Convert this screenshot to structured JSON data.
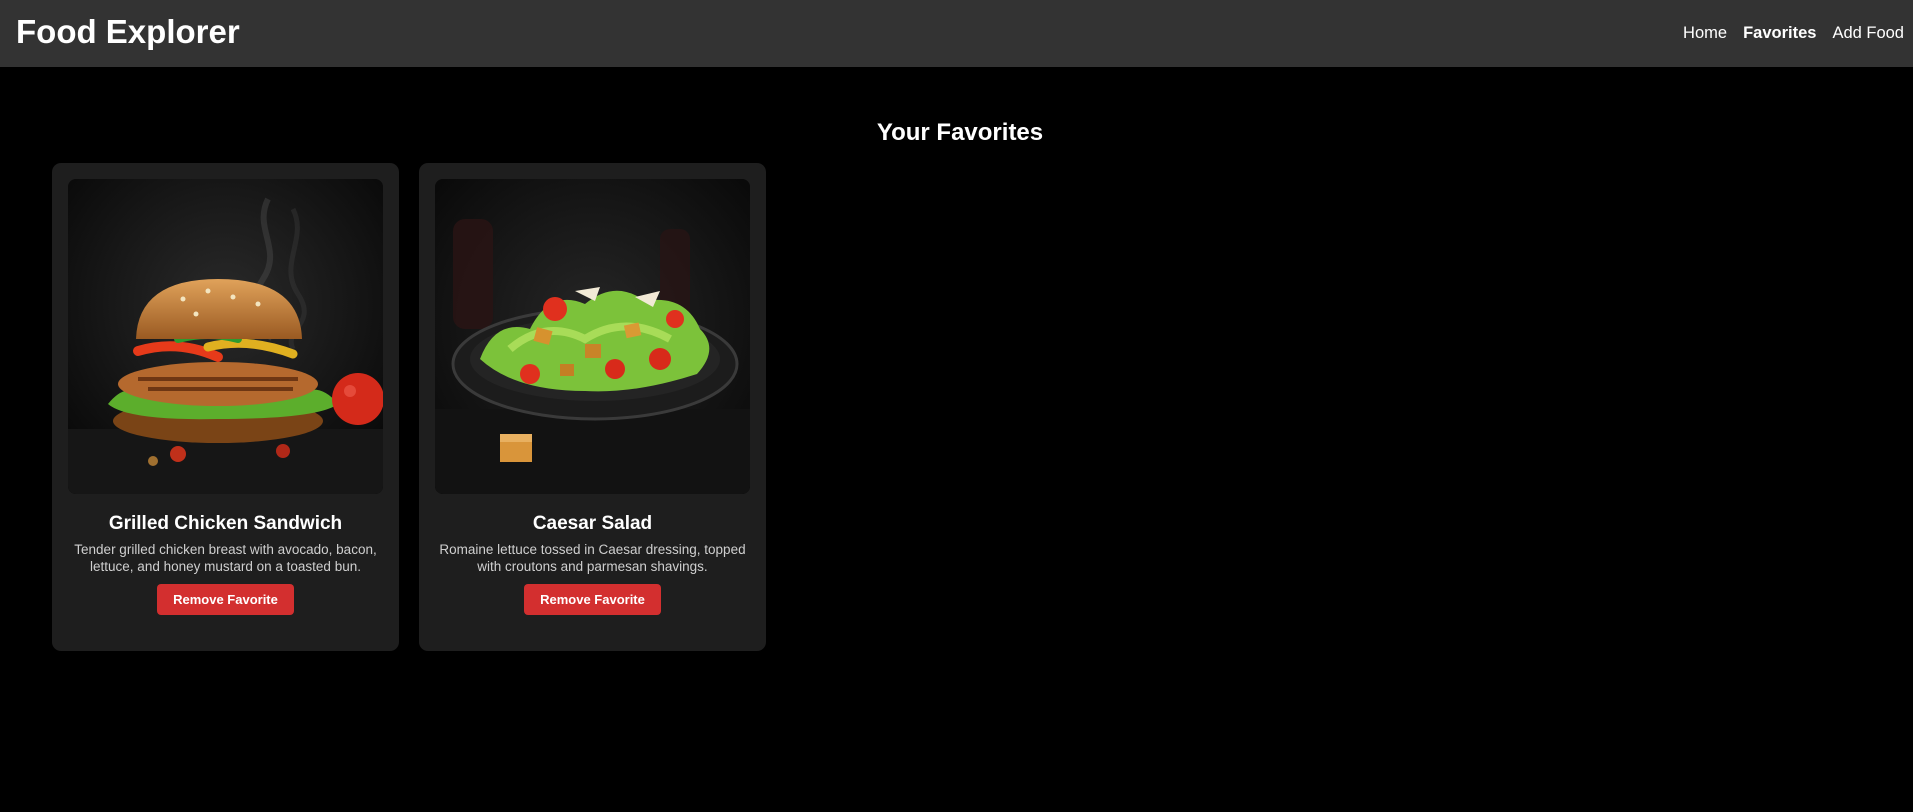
{
  "app": {
    "title": "Food Explorer"
  },
  "nav": {
    "items": [
      {
        "label": "Home",
        "active": false
      },
      {
        "label": "Favorites",
        "active": true
      },
      {
        "label": "Add Food",
        "active": false
      }
    ]
  },
  "main": {
    "heading": "Your Favorites",
    "favorites": [
      {
        "name": "Grilled Chicken Sandwich",
        "description": "Tender grilled chicken breast with avocado, bacon, lettuce, and honey mustard on a toasted bun.",
        "button_label": "Remove Favorite",
        "image": "grilled-chicken-sandwich-photo"
      },
      {
        "name": "Caesar Salad",
        "description": "Romaine lettuce tossed in Caesar dressing, topped with croutons and parmesan shavings.",
        "button_label": "Remove Favorite",
        "image": "caesar-salad-photo"
      }
    ]
  },
  "colors": {
    "topbar": "#333333",
    "background": "#000000",
    "card": "#1e1e1e",
    "danger": "#d32f2f"
  }
}
